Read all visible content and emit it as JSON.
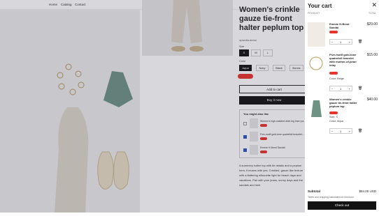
{
  "nav": {
    "links": [
      "Home",
      "Catalog",
      "Contact"
    ],
    "brand": "opwotia-demo"
  },
  "product": {
    "title": "Women's crinkle gauze tie-front halter peplum top",
    "vendor": "opwotia-demo",
    "size_label": "Size",
    "sizes": [
      "S",
      "M",
      "L"
    ],
    "color_label": "Color",
    "colors": [
      "Aqua",
      "Navy",
      "Black",
      "Bones"
    ],
    "add_to_cart": "Add to cart",
    "buy_now": "Buy it now",
    "also_like_title": "You might also like",
    "also_like": [
      {
        "name": "Women's high-waisted wide-leg linen pa...",
        "checked": false
      },
      {
        "name": "Five-motif gold-tone quatrefoil bracelet...",
        "checked": true
      },
      {
        "name": "Emmie H-Bend Sandal",
        "checked": true
      }
    ],
    "description": "A summery halter top with tie details and a peplum hem, it muses with yes. Crinkled, gauze-like texture with a flattering silhouette light for beach days and vacations. Pair with your jeans, sunny days and the sandals and heel."
  },
  "cart": {
    "title": "Your cart",
    "col_product": "PRODUCT",
    "col_total": "TOTAL",
    "items": [
      {
        "name": "Emmie H-Bend Sandal",
        "price": "$29.00",
        "variant": "",
        "qty": "1"
      },
      {
        "name": "Five-motif gold-tone quatrefoil bracelet with mother-of-pearl inlay",
        "price": "$15.00",
        "variant": "Color: Beige",
        "qty": "1"
      },
      {
        "name": "Women's crinkle gauze tie-front halter peplum top",
        "price": "$40.00",
        "variant": "Size: S",
        "variant2": "Color: Aqua",
        "qty": "1"
      }
    ],
    "subtotal_label": "Subtotal",
    "subtotal_value": "$84.00 USD",
    "note": "Taxes and shipping calculated at checkout",
    "checkout": "Check out"
  }
}
